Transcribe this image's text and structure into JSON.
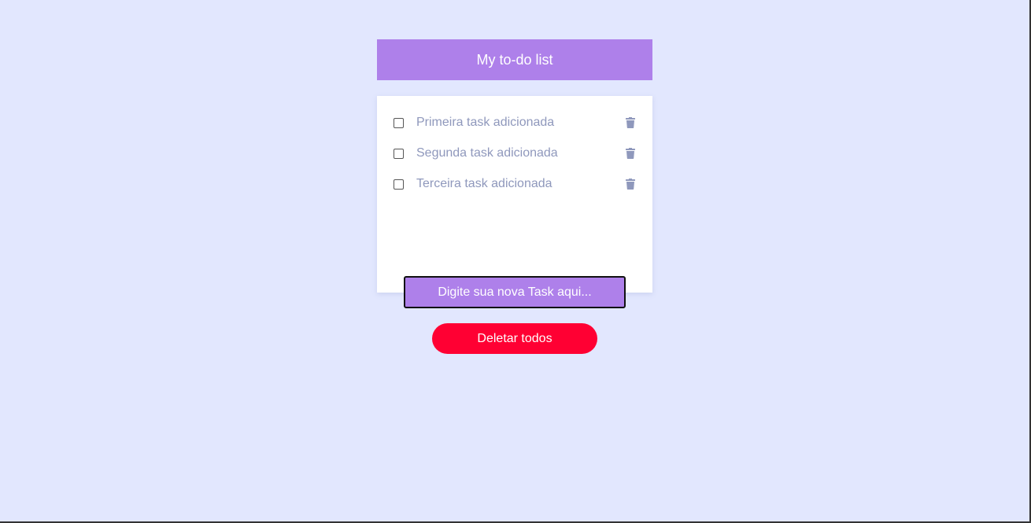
{
  "header": {
    "title": "My to-do list"
  },
  "tasks": [
    {
      "label": "Primeira task adicionada",
      "checked": false,
      "delete_icon": "trash-icon"
    },
    {
      "label": "Segunda task adicionada",
      "checked": false,
      "delete_icon": "trash-icon"
    },
    {
      "label": "Terceira task adicionada",
      "checked": false,
      "delete_icon": "trash-icon"
    }
  ],
  "new_task_input": {
    "value": "",
    "placeholder": "Digite sua nova Task aqui..."
  },
  "actions": {
    "delete_all_label": "Deletar todos"
  },
  "colors": {
    "background": "#e2e7fe",
    "accent": "#ae80ea",
    "danger": "#ff0033",
    "task_text": "#8f98bc"
  }
}
